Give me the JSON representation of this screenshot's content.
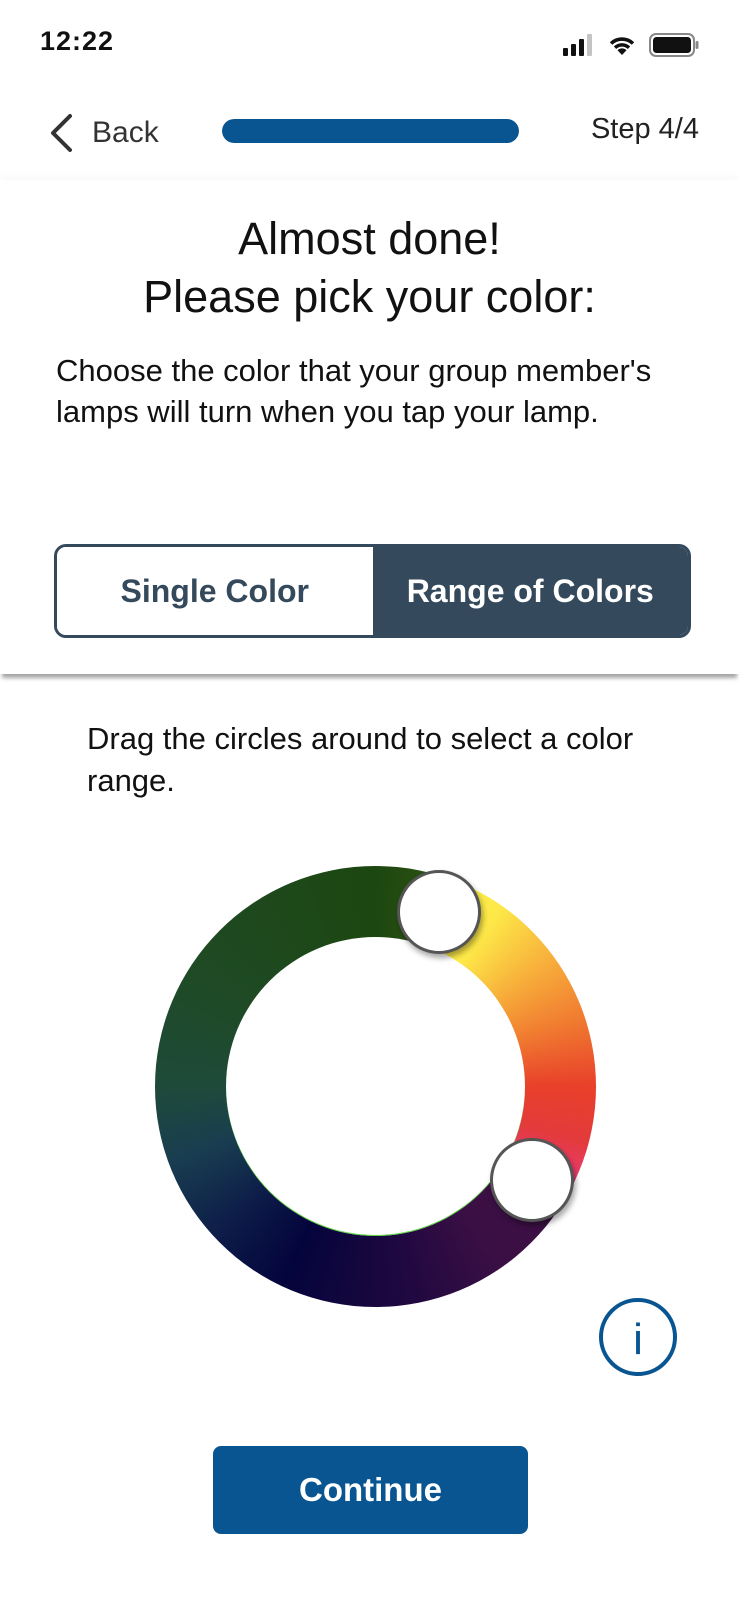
{
  "status_bar": {
    "time": "12:22",
    "icons": [
      "cellular-signal-icon",
      "wifi-icon",
      "battery-icon"
    ]
  },
  "nav": {
    "back_label": "Back",
    "back_icon": "chevron-left-icon",
    "progress_fraction": 1.0,
    "step_label": "Step 4/4"
  },
  "header": {
    "title_line1": "Almost done!",
    "title_line2": "Please pick your color:",
    "subtitle": "Choose the color that your group member's lamps will turn when you tap your lamp."
  },
  "mode_toggle": {
    "options": [
      {
        "label": "Single Color",
        "selected": false
      },
      {
        "label": "Range of Colors",
        "selected": true
      }
    ]
  },
  "instructions": "Drag the circles around to select a color range.",
  "info_button": {
    "icon": "info-icon",
    "glyph": "i"
  },
  "continue_label": "Continue",
  "colors": {
    "accent": "#085592",
    "toggle_dark": "#344a5c",
    "progress_track": "#d6dde6"
  }
}
